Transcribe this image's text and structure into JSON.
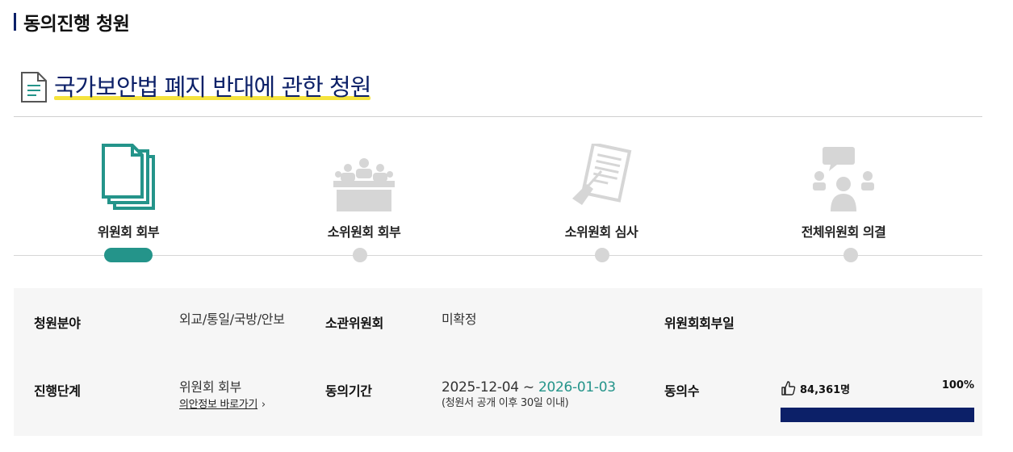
{
  "section": {
    "title": "동의진행 청원"
  },
  "petition": {
    "title": "국가보안법 폐지 반대에 관한 청원"
  },
  "steps": [
    {
      "label": "위원회 회부",
      "active": true,
      "icon": "documents-icon"
    },
    {
      "label": "소위원회 회부",
      "active": false,
      "icon": "meeting-icon"
    },
    {
      "label": "소위원회 심사",
      "active": false,
      "icon": "review-document-icon"
    },
    {
      "label": "전체위원회 의결",
      "active": false,
      "icon": "discussion-icon"
    }
  ],
  "info": {
    "field_label": "청원분야",
    "field_value": "외교/통일/국방/안보",
    "committee_label": "소관위원회",
    "committee_value": "미확정",
    "referral_date_label": "위원회회부일",
    "referral_date_value": "",
    "stage_label": "진행단계",
    "stage_value": "위원회 회부",
    "bill_link": "의안정보 바로가기",
    "period_label": "동의기간",
    "period_start": "2025-12-04 ~ ",
    "period_end": "2026-01-03",
    "period_note": "(청원서 공개 이후 30일 이내)",
    "agree_label": "동의수",
    "agree_count": "84,361명",
    "agree_percent_text": "100%",
    "agree_percent": 100
  },
  "colors": {
    "accent": "#24948a",
    "navy": "#0c2068",
    "highlight": "#f5e33d",
    "inactive": "#d6d6d6"
  }
}
